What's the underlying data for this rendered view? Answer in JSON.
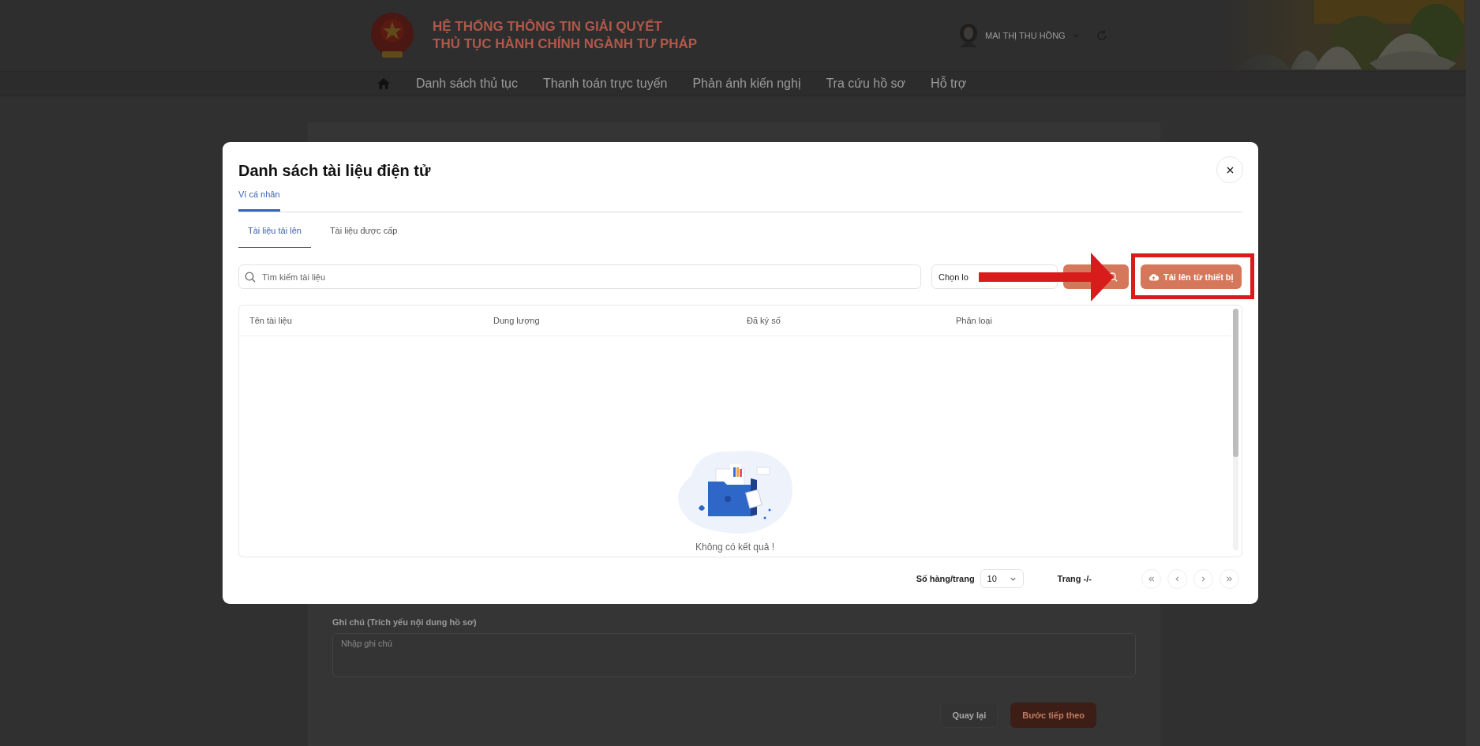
{
  "header": {
    "title_lines": [
      "HỆ THỐNG THÔNG TIN GIẢI QUYẾT",
      "THỦ TỤC HÀNH CHÍNH NGÀNH TƯ PHÁP"
    ],
    "user_name": "MAI THỊ THU HỒNG"
  },
  "nav": {
    "items": [
      {
        "label": "Danh sách thủ tục"
      },
      {
        "label": "Thanh toán trực tuyến"
      },
      {
        "label": "Phản ánh kiến nghị"
      },
      {
        "label": "Tra cứu hồ sơ"
      },
      {
        "label": "Hỗ trợ"
      }
    ]
  },
  "form": {
    "note_label": "Ghi chú (Trích yếu nội dung hồ sơ)",
    "note_placeholder": "Nhập ghi chú",
    "buttons": [
      {
        "label": "Quay lại",
        "kind": "secondary"
      },
      {
        "label": "Bước tiếp theo",
        "kind": "primary"
      }
    ]
  },
  "modal": {
    "title": "Danh sách tài liệu điện tử",
    "tabs": [
      {
        "label": "Ví cá nhân",
        "selected": true
      }
    ],
    "subtabs": [
      {
        "label": "Tài liệu tải lên",
        "selected": true
      },
      {
        "label": "Tài liệu được cấp",
        "selected": false
      }
    ],
    "search": {
      "placeholder": "Tìm kiếm tài liệu"
    },
    "type_select": {
      "text": "Chọn lo"
    },
    "upload_button": {
      "label": "Tải lên từ thiết bị"
    },
    "table": {
      "columns": [
        "Tên tài liệu",
        "Dung lượng",
        "Đã ký số",
        "Phân loại"
      ],
      "empty_text": "Không có kết quả !"
    },
    "pagination": {
      "rows_label": "Số hàng/trang",
      "rows_value": "10",
      "page_label": "Trang -/-"
    }
  },
  "annotations": [
    {
      "kind": "arrow"
    },
    {
      "kind": "frame"
    }
  ]
}
